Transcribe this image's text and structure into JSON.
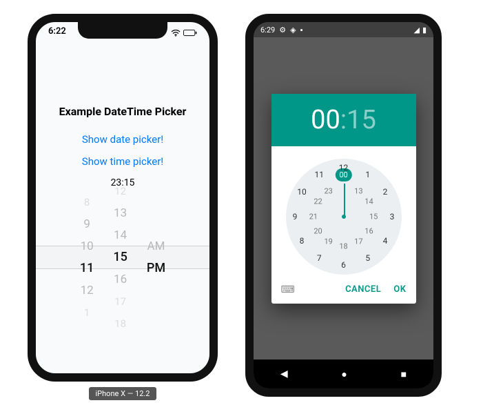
{
  "ios": {
    "status_time": "6:22",
    "title": "Example DateTime Picker",
    "link_date": "Show date picker!",
    "link_time": "Show time picker!",
    "selected_display": "23:15",
    "wheel": {
      "hours": [
        "8",
        "9",
        "10",
        "11",
        "12",
        "1"
      ],
      "minutes": [
        "12",
        "13",
        "14",
        "15",
        "16",
        "17",
        "18"
      ],
      "ampm": [
        "AM",
        "PM"
      ],
      "selected_hour": "11",
      "selected_minute": "15",
      "selected_ampm": "PM"
    },
    "caption": "iPhone X — 12.2"
  },
  "android": {
    "status_time": "6:29",
    "dialog": {
      "hour": "00",
      "minute": "15",
      "outer_numbers": [
        "12",
        "1",
        "2",
        "3",
        "4",
        "5",
        "6",
        "7",
        "8",
        "9",
        "10",
        "11"
      ],
      "inner_numbers": [
        "00",
        "13",
        "14",
        "15",
        "16",
        "17",
        "18",
        "19",
        "20",
        "21",
        "22",
        "23"
      ],
      "selected_inner": "00",
      "cancel": "CANCEL",
      "ok": "OK"
    }
  }
}
